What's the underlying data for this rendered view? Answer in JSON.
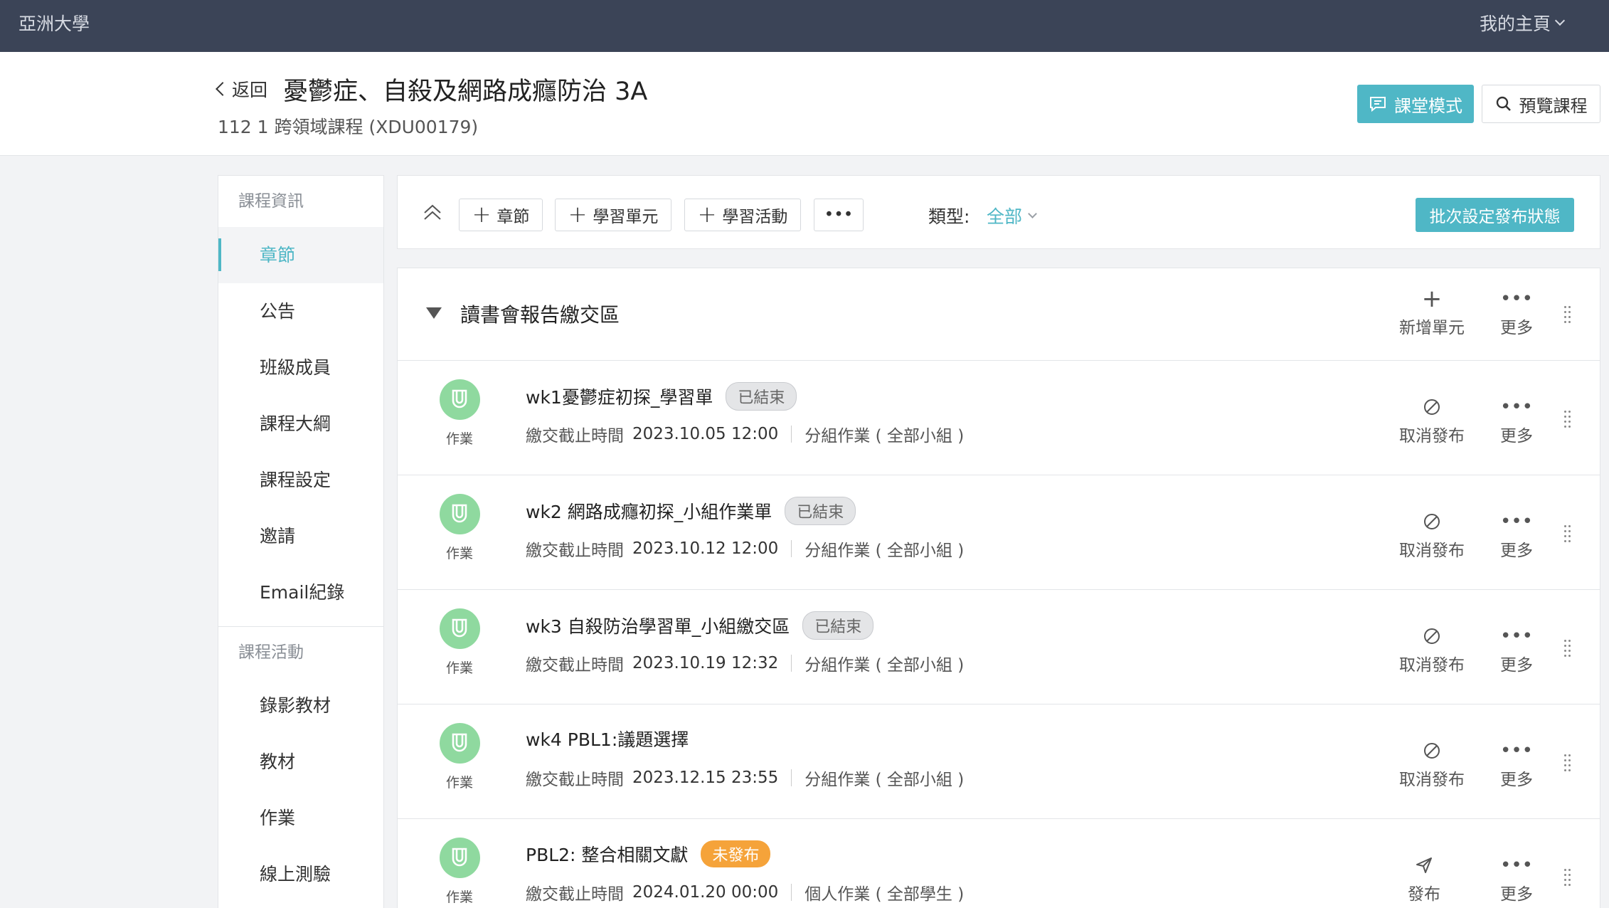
{
  "topbar": {
    "brand": "亞洲大學",
    "home": "我的主頁"
  },
  "header": {
    "back_label": "返回",
    "title": "憂鬱症、自殺及網路成癮防治 3A",
    "subtitle": "112 1 跨領域課程 (XDU00179)",
    "classroom_mode": "課堂模式",
    "preview_course": "預覽課程"
  },
  "sidebar": {
    "section1": "課程資訊",
    "items1": [
      "章節",
      "公告",
      "班級成員",
      "課程大綱",
      "課程設定",
      "邀請",
      "Email紀錄"
    ],
    "section2": "課程活動",
    "items2": [
      "錄影教材",
      "教材",
      "作業",
      "線上測驗"
    ]
  },
  "toolbar": {
    "chapter": "章節",
    "unit": "學習單元",
    "activity": "學習活動",
    "more": "•••",
    "type_label": "類型:",
    "type_value": "全部",
    "batch": "批次設定發布狀態"
  },
  "chapter": {
    "title": "讀書會報告繳交區",
    "add_unit": "新增單元",
    "more": "更多"
  },
  "rows": [
    {
      "category": "作業",
      "title": "wk1憂鬱症初探_學習單",
      "badge": "已結束",
      "deadline_label": "繳交截止時間",
      "deadline": "2023.10.05 12:00",
      "group": "分組作業 ( 全部小組 )",
      "action": "取消發布",
      "more": "更多"
    },
    {
      "category": "作業",
      "title": "wk2 網路成癮初探_小組作業單",
      "badge": "已結束",
      "deadline_label": "繳交截止時間",
      "deadline": "2023.10.12 12:00",
      "group": "分組作業 ( 全部小組 )",
      "action": "取消發布",
      "more": "更多"
    },
    {
      "category": "作業",
      "title": "wk3 自殺防治學習單_小組繳交區",
      "badge": "已結束",
      "deadline_label": "繳交截止時間",
      "deadline": "2023.10.19 12:32",
      "group": "分組作業 ( 全部小組 )",
      "action": "取消發布",
      "more": "更多"
    },
    {
      "category": "作業",
      "title": "wk4 PBL1:議題選擇",
      "badge": "",
      "deadline_label": "繳交截止時間",
      "deadline": "2023.12.15 23:55",
      "group": "分組作業 ( 全部小組 )",
      "action": "取消發布",
      "more": "更多"
    },
    {
      "category": "作業",
      "title": "PBL2:  整合相關文獻",
      "badge": "未發布",
      "deadline_label": "繳交截止時間",
      "deadline": "2024.01.20 00:00",
      "group": "個人作業 ( 全部學生 )",
      "action": "發布",
      "more": "更多"
    }
  ],
  "colors": {
    "topbar": "#3b4457",
    "accent": "#4fb7c6",
    "assignment_icon": "#8fd99f",
    "unpublished": "#f5a33a"
  }
}
